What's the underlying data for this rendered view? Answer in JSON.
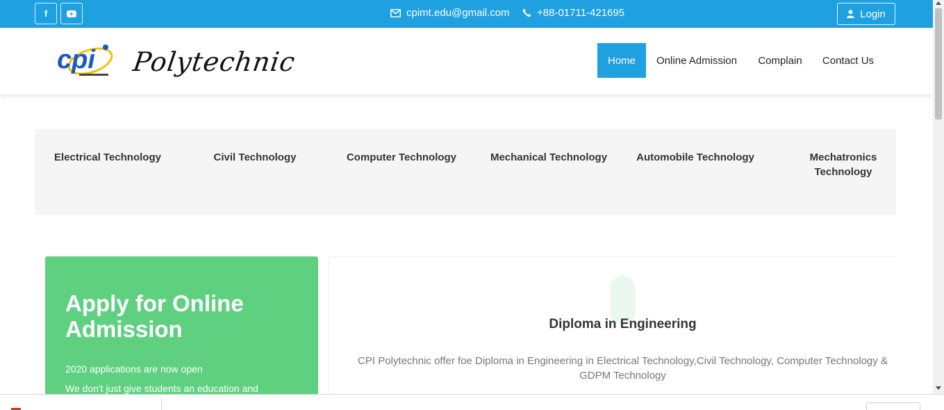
{
  "topbar": {
    "social": [
      {
        "icon": "facebook-icon",
        "glyph": "f"
      },
      {
        "icon": "youtube-icon",
        "glyph": "▶"
      }
    ],
    "email": "cpimt.edu@gmail.com",
    "phone": "+88-01711-421695",
    "login_label": "Login",
    "background": "#1fa0e0"
  },
  "header": {
    "logo_mark": "cpi",
    "logo_word": "Polytechnic",
    "nav": [
      {
        "label": "Home",
        "active": true
      },
      {
        "label": "Online Admission"
      },
      {
        "label": "Complain"
      },
      {
        "label": "Contact Us"
      }
    ]
  },
  "technologies": [
    "Electrical Technology",
    "Civil Technology",
    "Computer Technology",
    "Mechanical Technology",
    "Automobile Technology",
    "Mechatronics Technology"
  ],
  "apply_card": {
    "title": "Apply for Online Admission",
    "line1": "2020 applications are now open",
    "line2": "We don't just give students an education and",
    "color": "#5fd080"
  },
  "diploma_card": {
    "title": "Diploma in Engineering",
    "description": "CPI Polytechnic offer foe Diploma in Engineering in Electrical Technology,Civil Technology, Computer Technology & GDPM Technology"
  }
}
